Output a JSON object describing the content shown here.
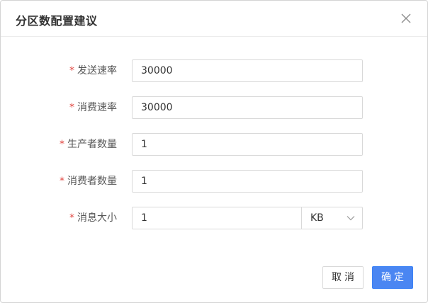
{
  "dialog": {
    "title": "分区数配置建议"
  },
  "form": {
    "required_mark": "*",
    "fields": [
      {
        "label": "发送速率",
        "value": "30000"
      },
      {
        "label": "消费速率",
        "value": "30000"
      },
      {
        "label": "生产者数量",
        "value": "1"
      },
      {
        "label": "消费者数量",
        "value": "1"
      },
      {
        "label": "消息大小",
        "value": "1",
        "unit": "KB"
      }
    ]
  },
  "footer": {
    "cancel_label": "取消",
    "ok_label": "确定"
  },
  "colors": {
    "required": "#e0443e",
    "primary": "#4a86f2"
  },
  "icons": {
    "close": "close-icon",
    "dropdown": "chevron-down-icon"
  }
}
